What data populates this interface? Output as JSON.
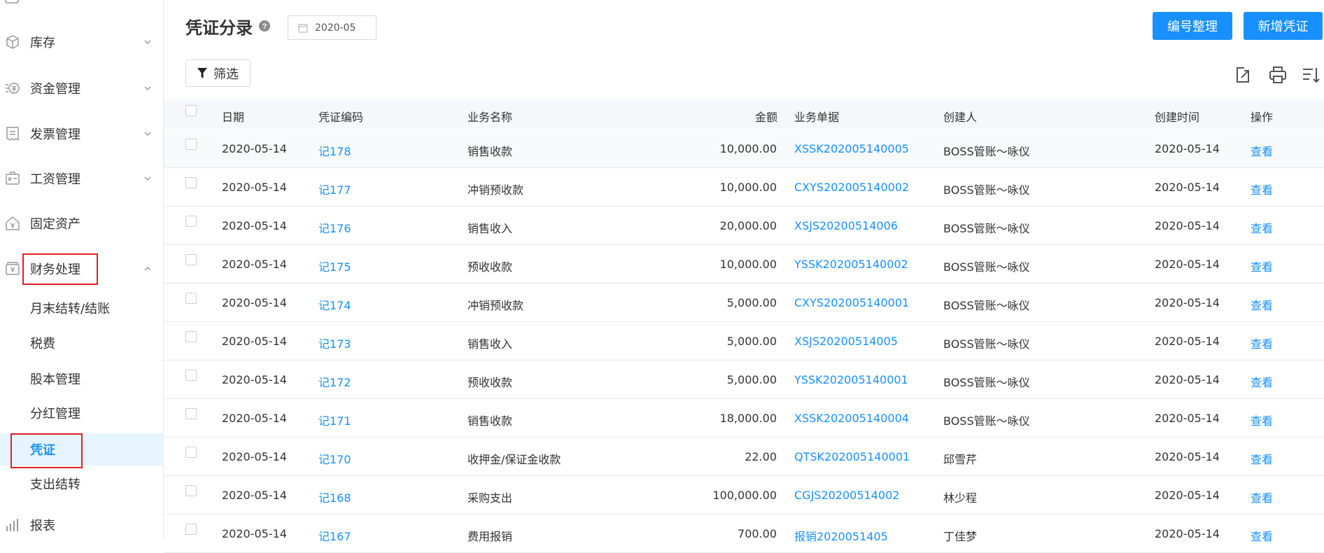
{
  "sidebar": {
    "items": [
      {
        "label": "库存",
        "icon": "box-icon"
      },
      {
        "label": "资金管理",
        "icon": "money-icon"
      },
      {
        "label": "发票管理",
        "icon": "invoice-icon"
      },
      {
        "label": "工资管理",
        "icon": "payroll-icon"
      },
      {
        "label": "固定资产",
        "icon": "asset-icon"
      },
      {
        "label": "财务处理",
        "icon": "finance-icon"
      }
    ],
    "sub_items": [
      {
        "label": "月末结转/结账"
      },
      {
        "label": "税费"
      },
      {
        "label": "股本管理"
      },
      {
        "label": "分红管理"
      },
      {
        "label": "凭证"
      },
      {
        "label": "支出结转"
      }
    ],
    "bottom_item": {
      "label": "报表",
      "icon": "chart-icon"
    }
  },
  "header": {
    "title": "凭证分录",
    "date_value": "2020-05",
    "renumber_label": "编号整理",
    "add_label": "新增凭证",
    "filter_label": "筛选"
  },
  "table": {
    "columns": [
      "日期",
      "凭证编码",
      "业务名称",
      "金额",
      "业务单据",
      "创建人",
      "创建时间",
      "操作"
    ],
    "rows": [
      {
        "date": "2020-05-14",
        "code": "记178",
        "business": "销售收款",
        "amount": "10,000.00",
        "doc": "XSSK202005140005",
        "creator": "BOSS管账～咏仪",
        "created": "2020-05-14",
        "action": "查看"
      },
      {
        "date": "2020-05-14",
        "code": "记177",
        "business": "冲销预收款",
        "amount": "10,000.00",
        "doc": "CXYS202005140002",
        "creator": "BOSS管账～咏仪",
        "created": "2020-05-14",
        "action": "查看"
      },
      {
        "date": "2020-05-14",
        "code": "记176",
        "business": "销售收入",
        "amount": "20,000.00",
        "doc": "XSJS20200514006",
        "creator": "BOSS管账～咏仪",
        "created": "2020-05-14",
        "action": "查看"
      },
      {
        "date": "2020-05-14",
        "code": "记175",
        "business": "预收收款",
        "amount": "10,000.00",
        "doc": "YSSK202005140002",
        "creator": "BOSS管账～咏仪",
        "created": "2020-05-14",
        "action": "查看"
      },
      {
        "date": "2020-05-14",
        "code": "记174",
        "business": "冲销预收款",
        "amount": "5,000.00",
        "doc": "CXYS202005140001",
        "creator": "BOSS管账～咏仪",
        "created": "2020-05-14",
        "action": "查看"
      },
      {
        "date": "2020-05-14",
        "code": "记173",
        "business": "销售收入",
        "amount": "5,000.00",
        "doc": "XSJS20200514005",
        "creator": "BOSS管账～咏仪",
        "created": "2020-05-14",
        "action": "查看"
      },
      {
        "date": "2020-05-14",
        "code": "记172",
        "business": "预收收款",
        "amount": "5,000.00",
        "doc": "YSSK202005140001",
        "creator": "BOSS管账～咏仪",
        "created": "2020-05-14",
        "action": "查看"
      },
      {
        "date": "2020-05-14",
        "code": "记171",
        "business": "销售收款",
        "amount": "18,000.00",
        "doc": "XSSK202005140004",
        "creator": "BOSS管账～咏仪",
        "created": "2020-05-14",
        "action": "查看"
      },
      {
        "date": "2020-05-14",
        "code": "记170",
        "business": "收押金/保证金收款",
        "amount": "22.00",
        "doc": "QTSK202005140001",
        "creator": "邱雪芹",
        "created": "2020-05-14",
        "action": "查看"
      },
      {
        "date": "2020-05-14",
        "code": "记168",
        "business": "采购支出",
        "amount": "100,000.00",
        "doc": "CGJS20200514002",
        "creator": "林少程",
        "created": "2020-05-14",
        "action": "查看"
      },
      {
        "date": "2020-05-14",
        "code": "记167",
        "business": "费用报销",
        "amount": "700.00",
        "doc": "报销2020051405",
        "creator": "丁佳梦",
        "created": "2020-05-14",
        "action": "查看"
      }
    ]
  },
  "colors": {
    "accent": "#1890ff",
    "highlight_box": "#e02020",
    "active_bg": "#e6f4ff"
  }
}
